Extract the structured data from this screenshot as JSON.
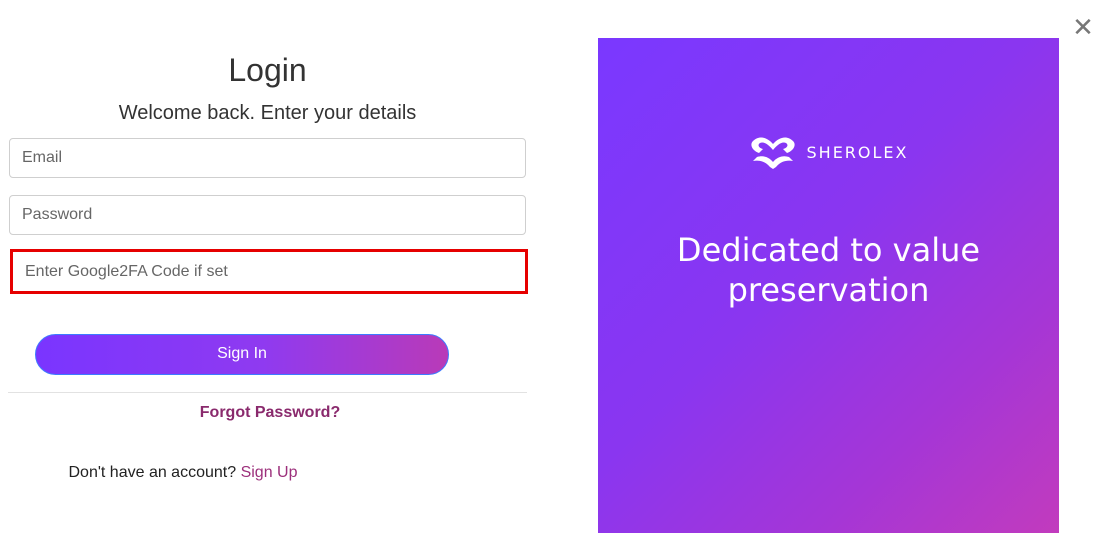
{
  "close": {
    "label": "✕"
  },
  "login": {
    "title": "Login",
    "subtitle": "Welcome back. Enter your details",
    "email": {
      "placeholder": "Email",
      "value": ""
    },
    "password": {
      "placeholder": "Password",
      "value": ""
    },
    "twofa": {
      "placeholder": "Enter Google2FA Code if set",
      "value": ""
    },
    "signin_label": "Sign In",
    "forgot_label": "Forgot Password?",
    "signup_prompt": "Don't have an account? ",
    "signup_label": "Sign Up"
  },
  "promo": {
    "brand_name": "SHEROLEX",
    "tagline_line1": "Dedicated to value",
    "tagline_line2": "preservation"
  },
  "colors": {
    "accent_purple": "#7a35ff",
    "accent_magenta": "#c23bbd",
    "link_color": "#8a2a6d",
    "highlight_border": "#e60000"
  }
}
